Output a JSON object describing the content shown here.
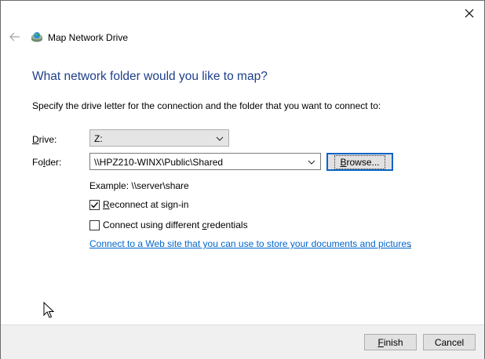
{
  "window": {
    "title": "Map Network Drive"
  },
  "heading": "What network folder would you like to map?",
  "instruction": "Specify the drive letter for the connection and the folder that you want to connect to:",
  "drive": {
    "label_accel": "D",
    "label_rest": "rive:",
    "value": "Z:"
  },
  "folder": {
    "label_pre": "Fo",
    "label_accel": "l",
    "label_post": "der:",
    "value": "\\\\HPZ210-WINX\\Public\\Shared"
  },
  "browse": {
    "label_accel": "B",
    "label_rest": "rowse..."
  },
  "example": "Example: \\\\server\\share",
  "reconnect": {
    "label_accel": "R",
    "label_rest": "econnect at sign-in",
    "checked": true
  },
  "credentials": {
    "label_pre": "Connect using different ",
    "label_accel": "c",
    "label_post": "redentials",
    "checked": false
  },
  "web_link": {
    "text": "Connect to a Web site that you can use to store your documents and pictures",
    "trailing": "."
  },
  "footer": {
    "finish_accel": "F",
    "finish_rest": "inish",
    "cancel": "Cancel"
  },
  "colors": {
    "heading": "#1e3f8a",
    "link": "#0066cc",
    "focus_border": "#0a64c8"
  },
  "icons": [
    "close-icon",
    "back-arrow-icon",
    "network-drive-icon",
    "chevron-down-icon",
    "checkmark-icon",
    "mouse-cursor-icon"
  ]
}
